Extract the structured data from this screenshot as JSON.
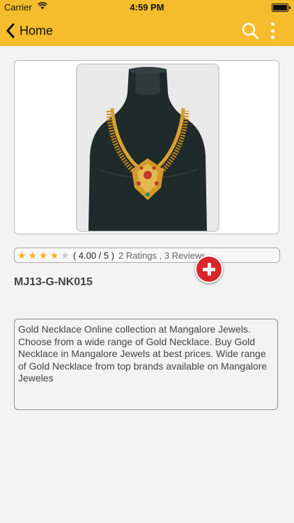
{
  "status": {
    "carrier": "Carrier",
    "time": "4:59 PM"
  },
  "nav": {
    "back_label": "Home"
  },
  "product": {
    "rating_value": "( 4.00 / 5 )",
    "rating_stars": 4,
    "rating_max": 5,
    "ratings_text": "2 Ratings , 3 Reviews",
    "code": "MJ13-G-NK015",
    "description": "Gold Necklace Online collection at Mangalore Jewels. Choose from a wide range of Gold Necklace. Buy Gold Necklace in Mangalore Jewels at best prices. Wide range of Gold Necklace from top brands available on Mangalore Jeweles"
  },
  "colors": {
    "accent": "#f5bd2c",
    "add_button": "#d9262b",
    "star": "#f3b11a"
  },
  "icons": {
    "back": "chevron-left-icon",
    "search": "search-icon",
    "more": "more-vertical-icon",
    "add": "plus-icon"
  }
}
